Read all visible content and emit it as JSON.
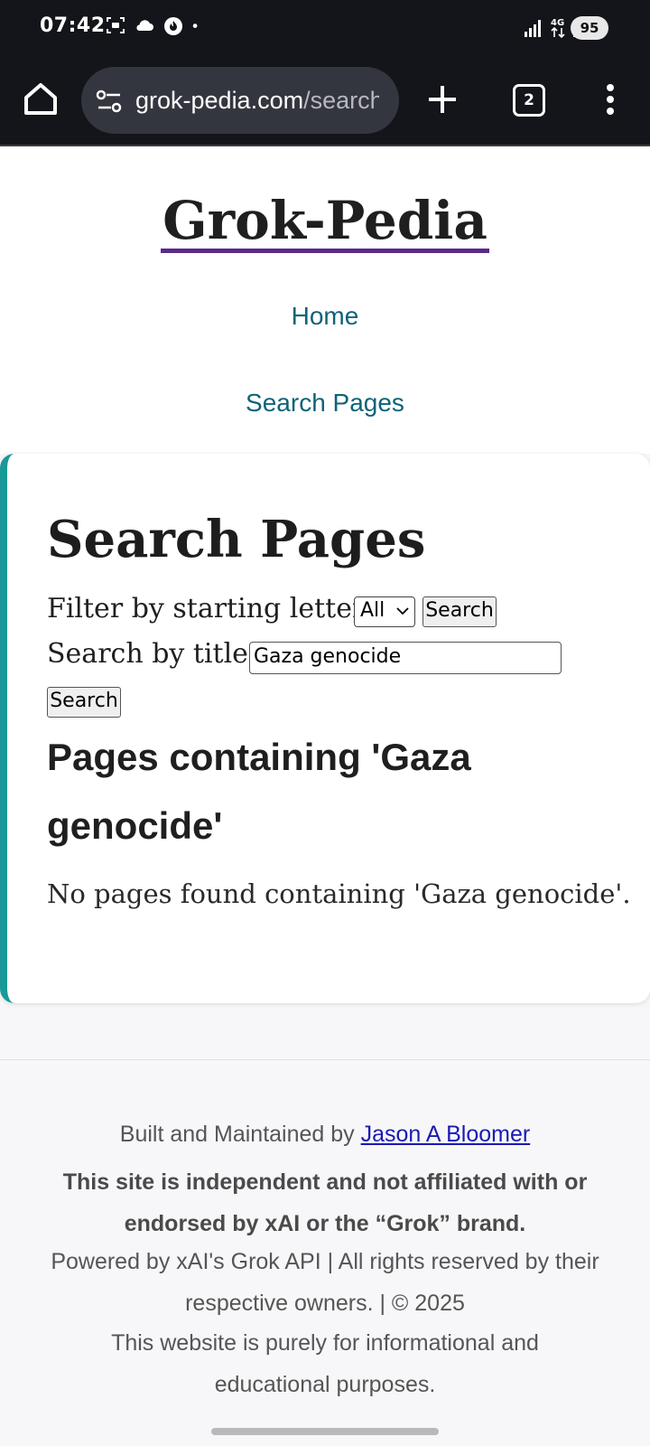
{
  "status_bar": {
    "time": "07:42",
    "network": "4G",
    "battery": "95",
    "icons": [
      "screenshot-icon",
      "cloud-icon",
      "fire-icon",
      "dot-icon",
      "signal-icon",
      "data-icon",
      "signal-icon"
    ]
  },
  "browser": {
    "url_domain": "grok-pedia.com",
    "url_path": "/search",
    "tab_count": "2",
    "icons": [
      "home-icon",
      "site-settings-icon",
      "plus-icon",
      "tabs-icon",
      "more-vert-icon"
    ]
  },
  "site": {
    "title": "Grok-Pedia",
    "nav": {
      "home": "Home",
      "search": "Search Pages"
    }
  },
  "search": {
    "heading": "Search Pages",
    "filter_label": "Filter by starting letter:",
    "filter_selected": "All",
    "filter_button": "Search",
    "title_label": "Search by title:",
    "title_value": "Gaza genocide",
    "title_button": "Search",
    "results_heading": "Pages containing 'Gaza genocide'",
    "no_results": "No pages found containing 'Gaza genocide'."
  },
  "footer": {
    "built_prefix": "Built and Maintained by ",
    "author": "Jason A Bloomer",
    "disclaimer": "This site is independent and not affiliated with or endorsed by xAI or the “Grok” brand.",
    "powered": "Powered by xAI's Grok API | All rights reserved by their respective owners. | © 2025",
    "purpose": "This website is purely for informational and educational purposes."
  },
  "colors": {
    "accent_teal": "#179997",
    "link": "#0f6378",
    "title_underline": "#5b2a86",
    "footer_link": "#1a1ab4"
  }
}
